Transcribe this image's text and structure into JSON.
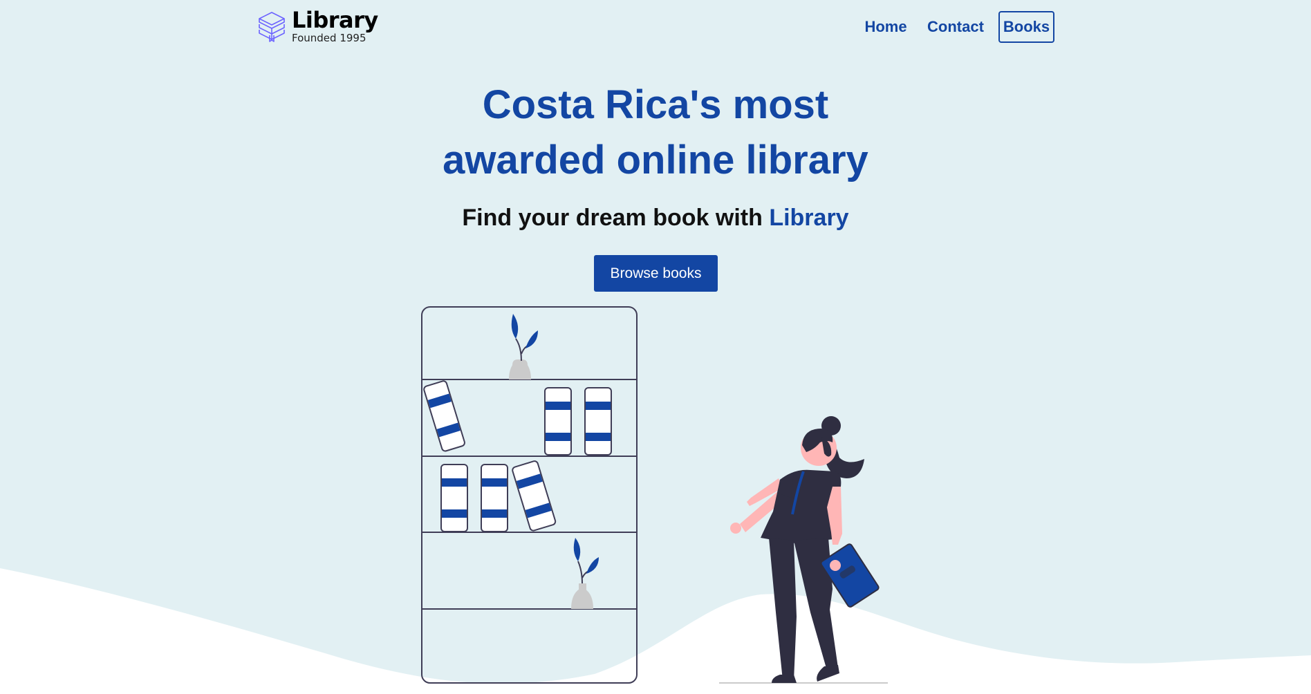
{
  "brand": {
    "title": "Library",
    "subtitle": "Founded 1995",
    "icon": "stacked-books-icon"
  },
  "nav": {
    "items": [
      {
        "label": "Home",
        "active": false
      },
      {
        "label": "Contact",
        "active": false
      },
      {
        "label": "Books",
        "active": true
      }
    ]
  },
  "hero": {
    "headline_line1": "Costa Rica's most",
    "headline_line2": "awarded online library",
    "tagline_prefix": "Find your dream book with ",
    "tagline_accent": "Library",
    "cta_label": "Browse books"
  },
  "colors": {
    "background": "#e2f0f3",
    "brand_blue": "#1346a3",
    "wave": "#ffffff",
    "illustration_dark": "#2f2e41",
    "skin": "#ffb6b6"
  },
  "illustration": {
    "shelf_icon": "bookshelf-illustration",
    "person_icon": "woman-reading-illustration"
  }
}
